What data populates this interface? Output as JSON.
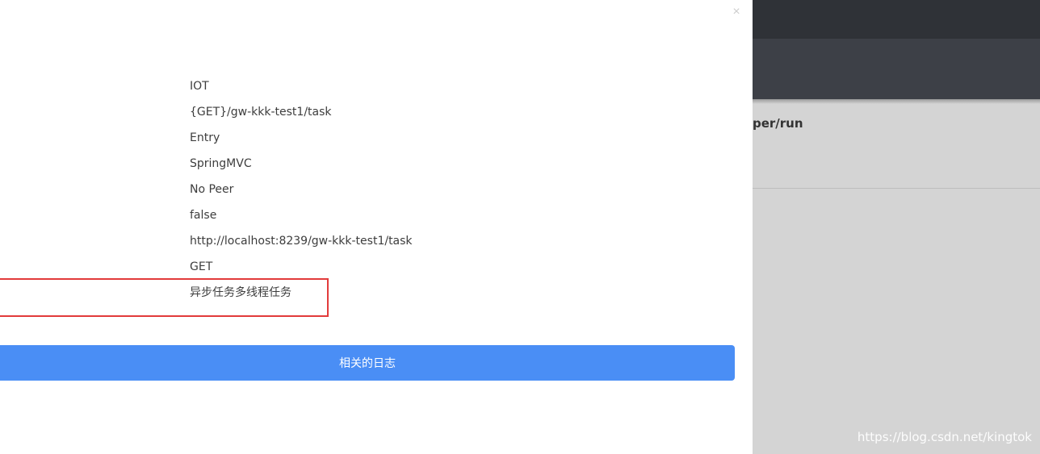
{
  "background_app": {
    "route_fragment": "per/run",
    "watermark": "https://blog.csdn.net/kingtok"
  },
  "drawer": {
    "close_icon": "×",
    "details": [
      "IOT",
      "{GET}/gw-kkk-test1/task",
      "Entry",
      "SpringMVC",
      "No Peer",
      "false",
      "http://localhost:8239/gw-kkk-test1/task",
      "GET",
      "异步任务多线程任务"
    ],
    "highlight_color": "#e23b3b",
    "button_label": "相关的日志",
    "button_color": "#4a8ef5"
  }
}
